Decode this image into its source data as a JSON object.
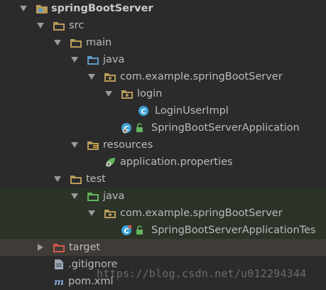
{
  "colors": {
    "folder": "#b99b5a",
    "source_folder": "#5d9cc8",
    "test_folder": "#5fb55c",
    "excluded_folder": "#d05a4a",
    "class_icon": "#3ea3d6",
    "test_row_bg": "#2c3328",
    "selected_row_bg": "#3f3b37"
  },
  "tree": {
    "project_name": "springBootServer",
    "src": "src",
    "main": "main",
    "main_java": "java",
    "main_package": "com.example.springBootServer",
    "login": "login",
    "login_user_impl": "LoginUserImpl",
    "app_class": "SpringBootServerApplication",
    "resources": "resources",
    "app_properties": "application.properties",
    "test": "test",
    "test_java": "java",
    "test_package": "com.example.springBootServer",
    "app_test_class": "SpringBootServerApplicationTes",
    "target": "target",
    "gitignore": ".gitignore",
    "pom": "pom.xml"
  },
  "watermark": "https://blog.csdn.net/u012294344"
}
